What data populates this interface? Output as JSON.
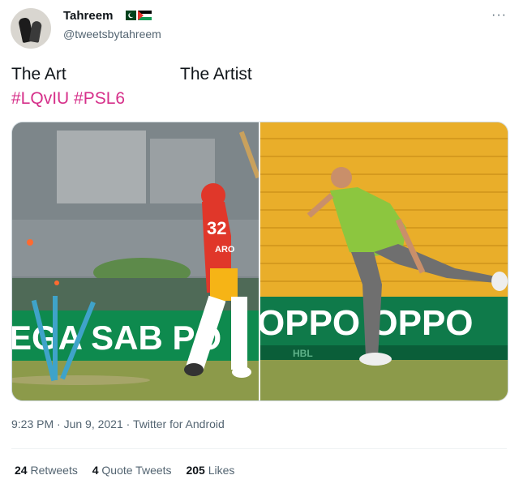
{
  "tweet": {
    "display_name": "Tahreem",
    "handle": "@tweetsbytahreem",
    "flags": [
      "pakistan-flag-icon",
      "palestine-flag-icon"
    ],
    "text_left": "The Art",
    "text_right": "The Artist",
    "hashtags": [
      "#LQvIU",
      "#PSL6"
    ],
    "timestamp": "9:23 PM · Jun 9, 2021",
    "separator": " · ",
    "source": "Twitter for Android",
    "stats": {
      "retweets_count": "24",
      "retweets_label": "Retweets",
      "quotes_count": "4",
      "quotes_label": "Quote Tweets",
      "likes_count": "205",
      "likes_label": "Likes"
    },
    "media": {
      "left_banner_text": "EGA SAB PO",
      "left_jersey_number": "32",
      "left_jersey_name": "ARO",
      "right_banner_text": "OPPO OPPO",
      "right_board_text": "HBL",
      "colors": {
        "hashtag": "#d6308a",
        "seats": "#e9ae2a",
        "jersey_red": "#e0372a",
        "jersey_green": "#8cc63f",
        "pitch": "#8c9a4a"
      }
    }
  }
}
